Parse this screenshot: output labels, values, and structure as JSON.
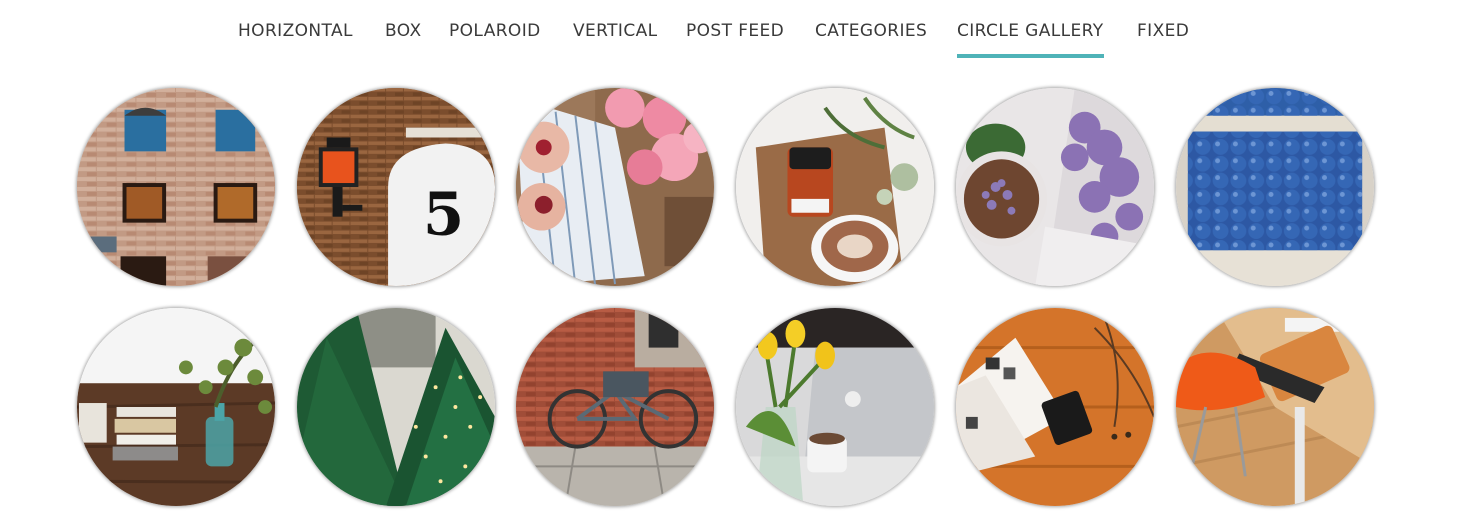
{
  "nav": {
    "tabs": [
      {
        "label": "HORIZONTAL",
        "active": false
      },
      {
        "label": "BOX",
        "active": false
      },
      {
        "label": "POLAROID",
        "active": false
      },
      {
        "label": "VERTICAL",
        "active": false
      },
      {
        "label": "POST FEED",
        "active": false
      },
      {
        "label": "CATEGORIES",
        "active": false
      },
      {
        "label": "CIRCLE GALLERY",
        "active": true
      },
      {
        "label": "FIXED",
        "active": false
      }
    ],
    "active_color": "#4fb3b8"
  },
  "gallery": {
    "items": [
      {
        "subject": "brick-building-windows",
        "sign_text": ""
      },
      {
        "subject": "brick-wall-lantern-number",
        "sign_text": "5"
      },
      {
        "subject": "smoothie-bowls-peonies",
        "sign_text": ""
      },
      {
        "subject": "coffee-jam-plant",
        "sign_text": ""
      },
      {
        "subject": "drink-lilac",
        "sign_text": ""
      },
      {
        "subject": "blueberries",
        "sign_text": ""
      },
      {
        "subject": "table-books-eucalyptus",
        "sign_text": ""
      },
      {
        "subject": "christmas-trees",
        "sign_text": ""
      },
      {
        "subject": "bicycle-brick-wall",
        "sign_text": ""
      },
      {
        "subject": "tulips-laptop-coffee",
        "sign_text": ""
      },
      {
        "subject": "desk-magazine-wallet",
        "sign_text": ""
      },
      {
        "subject": "desk-orange-chair",
        "sign_text": ""
      }
    ]
  }
}
